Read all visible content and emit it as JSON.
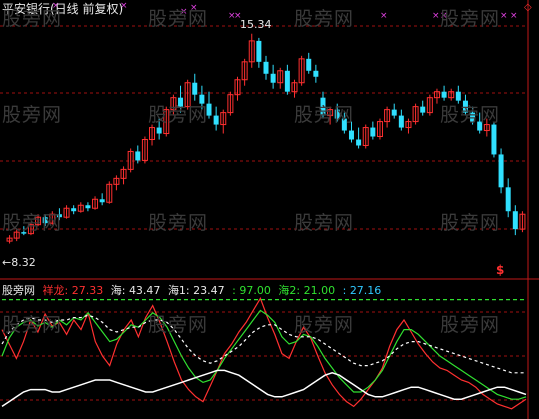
{
  "title": "平安银行(日线 前复权)",
  "watermark": "股旁网",
  "annotations": {
    "high_label": "15.34",
    "low_label": "8.32"
  },
  "signal_glyph": "$",
  "corner_glyph": "◇",
  "indicator": {
    "name": "股旁网",
    "items": [
      {
        "label": "祥龙:",
        "value": "27.33",
        "color": "#ff3030"
      },
      {
        "label": "海:",
        "value": "43.47",
        "color": "#e8e8e8"
      },
      {
        "label": "海1:",
        "value": "23.47",
        "color": "#e8e8e8"
      },
      {
        "label": ":",
        "value": "97.00",
        "color": "#30e030"
      },
      {
        "label": "海2:",
        "value": "21.00",
        "color": "#30e030"
      },
      {
        "label": ":",
        "value": "27.16",
        "color": "#30c8ff"
      }
    ]
  },
  "colors": {
    "up": "#ff3030",
    "down": "#30e0ff",
    "grid": "#a01010",
    "green": "#30e030",
    "white": "#ffffff",
    "mark": "#e040e0"
  },
  "chart_data": [
    {
      "type": "candlestick",
      "title": "平安银行(日线 前复权)",
      "ylim": [
        7.5,
        16.0
      ],
      "candles": [
        {
          "o": 8.4,
          "h": 8.6,
          "l": 8.32,
          "c": 8.5
        },
        {
          "o": 8.5,
          "h": 8.8,
          "l": 8.4,
          "c": 8.7
        },
        {
          "o": 8.7,
          "h": 8.9,
          "l": 8.6,
          "c": 8.65
        },
        {
          "o": 8.65,
          "h": 9.0,
          "l": 8.6,
          "c": 8.95
        },
        {
          "o": 8.95,
          "h": 9.3,
          "l": 8.9,
          "c": 9.2
        },
        {
          "o": 9.2,
          "h": 9.3,
          "l": 8.9,
          "c": 9.0
        },
        {
          "o": 9.0,
          "h": 9.4,
          "l": 8.95,
          "c": 9.3
        },
        {
          "o": 9.3,
          "h": 9.5,
          "l": 9.1,
          "c": 9.2
        },
        {
          "o": 9.2,
          "h": 9.6,
          "l": 9.15,
          "c": 9.5
        },
        {
          "o": 9.5,
          "h": 9.6,
          "l": 9.3,
          "c": 9.4
        },
        {
          "o": 9.4,
          "h": 9.7,
          "l": 9.35,
          "c": 9.6
        },
        {
          "o": 9.6,
          "h": 9.7,
          "l": 9.4,
          "c": 9.5
        },
        {
          "o": 9.5,
          "h": 9.9,
          "l": 9.45,
          "c": 9.8
        },
        {
          "o": 9.8,
          "h": 10.0,
          "l": 9.6,
          "c": 9.7
        },
        {
          "o": 9.7,
          "h": 10.4,
          "l": 9.65,
          "c": 10.3
        },
        {
          "o": 10.3,
          "h": 10.6,
          "l": 10.1,
          "c": 10.5
        },
        {
          "o": 10.5,
          "h": 10.9,
          "l": 10.3,
          "c": 10.8
        },
        {
          "o": 10.8,
          "h": 11.5,
          "l": 10.7,
          "c": 11.4
        },
        {
          "o": 11.4,
          "h": 11.6,
          "l": 11.0,
          "c": 11.1
        },
        {
          "o": 11.1,
          "h": 11.9,
          "l": 11.0,
          "c": 11.8
        },
        {
          "o": 11.8,
          "h": 12.3,
          "l": 11.6,
          "c": 12.2
        },
        {
          "o": 12.2,
          "h": 12.5,
          "l": 11.8,
          "c": 12.0
        },
        {
          "o": 12.0,
          "h": 12.9,
          "l": 11.9,
          "c": 12.8
        },
        {
          "o": 12.8,
          "h": 13.3,
          "l": 12.6,
          "c": 13.2
        },
        {
          "o": 13.2,
          "h": 13.6,
          "l": 12.7,
          "c": 12.9
        },
        {
          "o": 12.9,
          "h": 13.8,
          "l": 12.8,
          "c": 13.7
        },
        {
          "o": 13.7,
          "h": 14.0,
          "l": 13.1,
          "c": 13.3
        },
        {
          "o": 13.3,
          "h": 13.6,
          "l": 12.8,
          "c": 13.0
        },
        {
          "o": 13.0,
          "h": 13.4,
          "l": 12.5,
          "c": 12.6
        },
        {
          "o": 12.6,
          "h": 12.9,
          "l": 12.1,
          "c": 12.3
        },
        {
          "o": 12.3,
          "h": 12.8,
          "l": 12.0,
          "c": 12.7
        },
        {
          "o": 12.7,
          "h": 13.4,
          "l": 12.6,
          "c": 13.3
        },
        {
          "o": 13.3,
          "h": 13.9,
          "l": 13.1,
          "c": 13.8
        },
        {
          "o": 13.8,
          "h": 14.5,
          "l": 13.6,
          "c": 14.4
        },
        {
          "o": 14.4,
          "h": 15.34,
          "l": 14.2,
          "c": 15.1
        },
        {
          "o": 15.1,
          "h": 15.2,
          "l": 14.2,
          "c": 14.4
        },
        {
          "o": 14.4,
          "h": 14.6,
          "l": 13.8,
          "c": 14.0
        },
        {
          "o": 14.0,
          "h": 14.3,
          "l": 13.5,
          "c": 13.7
        },
        {
          "o": 13.7,
          "h": 14.2,
          "l": 13.5,
          "c": 14.1
        },
        {
          "o": 14.1,
          "h": 14.3,
          "l": 13.3,
          "c": 13.4
        },
        {
          "o": 13.4,
          "h": 13.8,
          "l": 13.2,
          "c": 13.7
        },
        {
          "o": 13.7,
          "h": 14.6,
          "l": 13.6,
          "c": 14.5
        },
        {
          "o": 14.5,
          "h": 14.7,
          "l": 14.0,
          "c": 14.1
        },
        {
          "o": 14.1,
          "h": 14.3,
          "l": 13.7,
          "c": 13.9
        },
        {
          "o": 13.2,
          "h": 13.4,
          "l": 12.5,
          "c": 12.6
        },
        {
          "o": 12.6,
          "h": 12.9,
          "l": 12.3,
          "c": 12.8
        },
        {
          "o": 12.8,
          "h": 13.0,
          "l": 12.4,
          "c": 12.5
        },
        {
          "o": 12.5,
          "h": 12.7,
          "l": 12.0,
          "c": 12.1
        },
        {
          "o": 12.1,
          "h": 12.4,
          "l": 11.7,
          "c": 11.8
        },
        {
          "o": 11.8,
          "h": 12.2,
          "l": 11.5,
          "c": 11.6
        },
        {
          "o": 11.6,
          "h": 12.3,
          "l": 11.5,
          "c": 12.2
        },
        {
          "o": 12.2,
          "h": 12.4,
          "l": 11.8,
          "c": 11.9
        },
        {
          "o": 11.9,
          "h": 12.5,
          "l": 11.8,
          "c": 12.4
        },
        {
          "o": 12.4,
          "h": 12.9,
          "l": 12.2,
          "c": 12.8
        },
        {
          "o": 12.8,
          "h": 13.0,
          "l": 12.5,
          "c": 12.6
        },
        {
          "o": 12.6,
          "h": 12.8,
          "l": 12.1,
          "c": 12.2
        },
        {
          "o": 12.2,
          "h": 12.5,
          "l": 12.0,
          "c": 12.4
        },
        {
          "o": 12.4,
          "h": 13.0,
          "l": 12.3,
          "c": 12.9
        },
        {
          "o": 12.9,
          "h": 13.1,
          "l": 12.6,
          "c": 12.7
        },
        {
          "o": 12.7,
          "h": 13.3,
          "l": 12.6,
          "c": 13.2
        },
        {
          "o": 13.2,
          "h": 13.5,
          "l": 13.0,
          "c": 13.4
        },
        {
          "o": 13.4,
          "h": 13.6,
          "l": 13.1,
          "c": 13.2
        },
        {
          "o": 13.2,
          "h": 13.5,
          "l": 13.1,
          "c": 13.4
        },
        {
          "o": 13.4,
          "h": 13.6,
          "l": 13.0,
          "c": 13.1
        },
        {
          "o": 13.1,
          "h": 13.3,
          "l": 12.6,
          "c": 12.7
        },
        {
          "o": 12.7,
          "h": 12.9,
          "l": 12.3,
          "c": 12.4
        },
        {
          "o": 12.4,
          "h": 12.7,
          "l": 12.0,
          "c": 12.1
        },
        {
          "o": 12.1,
          "h": 12.5,
          "l": 11.9,
          "c": 12.3
        },
        {
          "o": 12.3,
          "h": 12.4,
          "l": 11.2,
          "c": 11.3
        },
        {
          "o": 11.3,
          "h": 11.5,
          "l": 10.0,
          "c": 10.2
        },
        {
          "o": 10.2,
          "h": 10.5,
          "l": 9.2,
          "c": 9.4
        },
        {
          "o": 9.4,
          "h": 9.6,
          "l": 8.6,
          "c": 8.8
        },
        {
          "o": 8.8,
          "h": 9.4,
          "l": 8.7,
          "c": 9.3
        }
      ]
    },
    {
      "type": "line",
      "name": "indicator",
      "ylim": [
        0,
        100
      ],
      "series": [
        {
          "name": "祥龙",
          "color": "#ff3030",
          "values": [
            72,
            60,
            48,
            62,
            80,
            70,
            85,
            75,
            78,
            68,
            80,
            72,
            86,
            62,
            50,
            42,
            60,
            72,
            80,
            66,
            82,
            92,
            78,
            62,
            45,
            30,
            22,
            16,
            12,
            25,
            38,
            52,
            60,
            70,
            78,
            88,
            98,
            82,
            68,
            52,
            48,
            62,
            74,
            65,
            50,
            36,
            26,
            18,
            12,
            8,
            14,
            22,
            30,
            40,
            58,
            72,
            80,
            70,
            60,
            52,
            45,
            40,
            38,
            34,
            30,
            28,
            24,
            18,
            14,
            10,
            8,
            6,
            10,
            14
          ]
        },
        {
          "name": "海",
          "color": "#30e030",
          "values": [
            50,
            65,
            74,
            78,
            80,
            75,
            78,
            74,
            80,
            76,
            82,
            80,
            86,
            78,
            70,
            62,
            64,
            70,
            76,
            74,
            80,
            86,
            82,
            74,
            62,
            50,
            40,
            32,
            28,
            30,
            38,
            48,
            56,
            64,
            72,
            80,
            88,
            84,
            78,
            66,
            60,
            62,
            68,
            66,
            58,
            48,
            40,
            32,
            26,
            20,
            20,
            24,
            30,
            38,
            50,
            62,
            72,
            72,
            68,
            62,
            56,
            50,
            46,
            42,
            38,
            34,
            30,
            26,
            22,
            18,
            16,
            14,
            14,
            16
          ]
        },
        {
          "name": "海1",
          "color": "#ffffff",
          "values": [
            60,
            70,
            76,
            80,
            82,
            80,
            80,
            78,
            80,
            80,
            82,
            82,
            84,
            82,
            78,
            72,
            70,
            72,
            74,
            74,
            78,
            80,
            80,
            78,
            72,
            64,
            56,
            50,
            46,
            44,
            46,
            50,
            54,
            58,
            64,
            70,
            74,
            76,
            76,
            72,
            68,
            66,
            66,
            66,
            64,
            60,
            56,
            52,
            48,
            44,
            42,
            42,
            44,
            46,
            50,
            56,
            60,
            62,
            62,
            60,
            58,
            56,
            54,
            52,
            50,
            48,
            46,
            44,
            42,
            40,
            38,
            36,
            36,
            36
          ]
        },
        {
          "name": "海2",
          "color": "#ffffff",
          "values": [
            8,
            12,
            16,
            20,
            22,
            22,
            22,
            20,
            20,
            22,
            24,
            26,
            28,
            30,
            30,
            30,
            28,
            26,
            24,
            22,
            20,
            20,
            22,
            24,
            26,
            28,
            30,
            32,
            34,
            36,
            38,
            38,
            36,
            34,
            30,
            26,
            22,
            18,
            16,
            16,
            18,
            20,
            22,
            26,
            30,
            34,
            36,
            34,
            30,
            26,
            22,
            18,
            16,
            16,
            18,
            20,
            22,
            24,
            24,
            22,
            20,
            18,
            16,
            14,
            14,
            16,
            18,
            20,
            22,
            24,
            24,
            22,
            20,
            18
          ]
        },
        {
          "name": "",
          "color": "#30e030",
          "values": [
            97,
            97,
            97,
            97,
            97,
            97,
            97,
            97,
            97,
            97,
            97,
            97,
            97,
            97,
            97,
            97,
            97,
            97,
            97,
            97,
            97,
            97,
            97,
            97,
            97,
            97,
            97,
            97,
            97,
            97,
            97,
            97,
            97,
            97,
            97,
            97,
            97,
            97,
            97,
            97,
            97,
            97,
            97,
            97,
            97,
            97,
            97,
            97,
            97,
            97,
            97,
            97,
            97,
            97,
            97,
            97,
            97,
            97,
            97,
            97,
            97,
            97,
            97,
            97,
            97,
            97,
            97,
            97,
            97,
            97,
            97,
            97,
            97,
            97
          ]
        }
      ]
    }
  ]
}
